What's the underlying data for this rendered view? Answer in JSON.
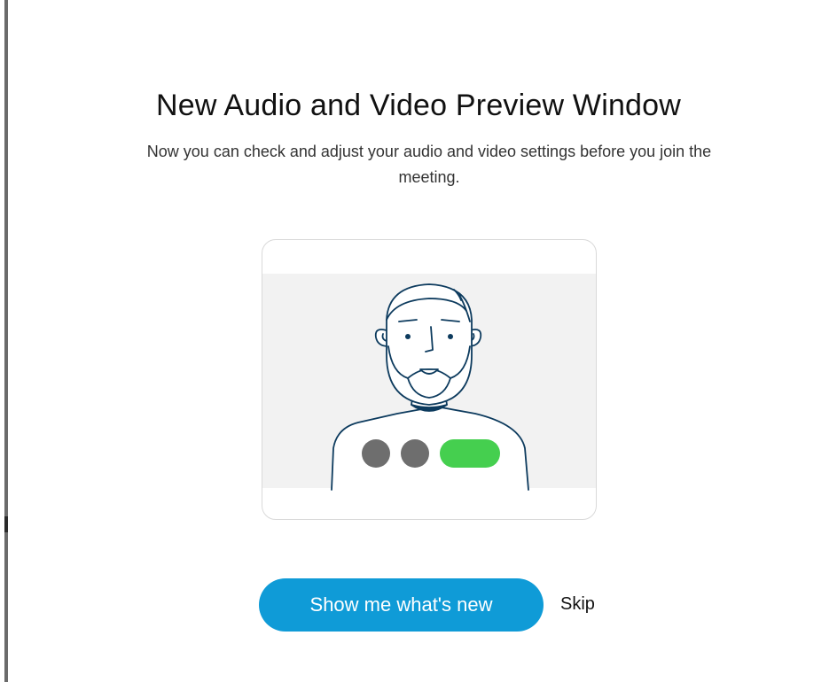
{
  "dialog": {
    "title": "New Audio and Video Preview Window",
    "description": "Now you can check and adjust your audio and video settings before you join the meeting."
  },
  "illustration": {
    "video_area_color": "#f2f2f2",
    "line_color": "#0d3b5e",
    "control_colors": {
      "mute": "#6e6e6e",
      "video": "#6e6e6e",
      "join": "#45cf4f"
    },
    "icons": [
      "person-illustration",
      "mute-button-icon",
      "video-button-icon",
      "join-button-icon"
    ]
  },
  "actions": {
    "primary_label": "Show me what's new",
    "primary_color": "#0f9bd7",
    "secondary_label": "Skip"
  }
}
